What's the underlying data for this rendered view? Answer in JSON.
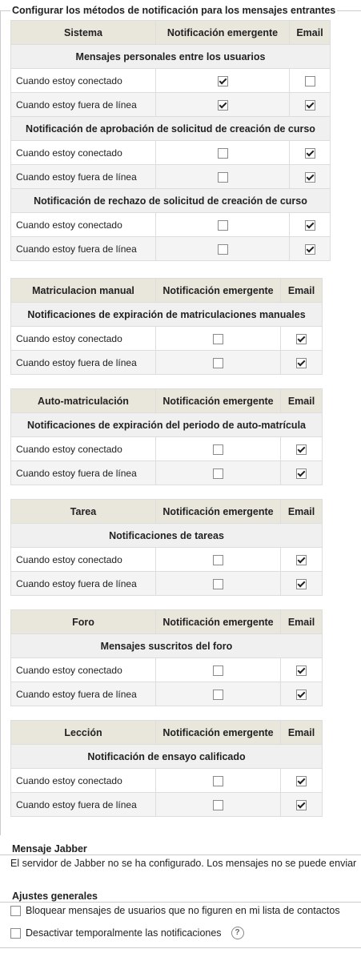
{
  "legend": "Configurar los métodos de notificación para los mensajes entrantes",
  "col_popup": "Notificación emergente",
  "col_email": "Email",
  "row_online": "Cuando estoy conectado",
  "row_offline": "Cuando estoy fuera de línea",
  "tables": [
    {
      "provider": "Sistema",
      "groups": [
        {
          "title": "Mensajes personales entre los usuarios",
          "online": {
            "popup": true,
            "email": false
          },
          "offline": {
            "popup": true,
            "email": true
          }
        },
        {
          "title": "Notificación de aprobación de solicitud de creación de curso",
          "online": {
            "popup": false,
            "email": true
          },
          "offline": {
            "popup": false,
            "email": true
          }
        },
        {
          "title": "Notificación de rechazo de solicitud de creación de curso",
          "online": {
            "popup": false,
            "email": true
          },
          "offline": {
            "popup": false,
            "email": true
          }
        }
      ]
    },
    {
      "provider": "Matriculacion manual",
      "groups": [
        {
          "title": "Notificaciones de expiración de matriculaciones manuales",
          "online": {
            "popup": false,
            "email": true
          },
          "offline": {
            "popup": false,
            "email": true
          }
        }
      ]
    },
    {
      "provider": "Auto-matriculación",
      "groups": [
        {
          "title": "Notificaciones de expiración del periodo de auto-matrícula",
          "online": {
            "popup": false,
            "email": true
          },
          "offline": {
            "popup": false,
            "email": true
          }
        }
      ]
    },
    {
      "provider": "Tarea",
      "groups": [
        {
          "title": "Notificaciones de tareas",
          "online": {
            "popup": false,
            "email": true
          },
          "offline": {
            "popup": false,
            "email": true
          }
        }
      ]
    },
    {
      "provider": "Foro",
      "groups": [
        {
          "title": "Mensajes suscritos del foro",
          "online": {
            "popup": false,
            "email": true
          },
          "offline": {
            "popup": false,
            "email": true
          }
        }
      ]
    },
    {
      "provider": "Lección",
      "groups": [
        {
          "title": "Notificación de ensayo calificado",
          "online": {
            "popup": false,
            "email": true
          },
          "offline": {
            "popup": false,
            "email": true
          }
        }
      ]
    }
  ],
  "jabber": {
    "legend": "Mensaje Jabber",
    "text": "El servidor de Jabber no se ha configurado. Los mensajes no se puede enviar"
  },
  "general": {
    "legend": "Ajustes generales",
    "block_label": "Bloquear mensajes de usuarios que no figuren en mi lista de contactos",
    "block_checked": false,
    "disable_label": "Desactivar temporalmente las notificaciones",
    "disable_checked": false,
    "help_glyph": "?"
  }
}
